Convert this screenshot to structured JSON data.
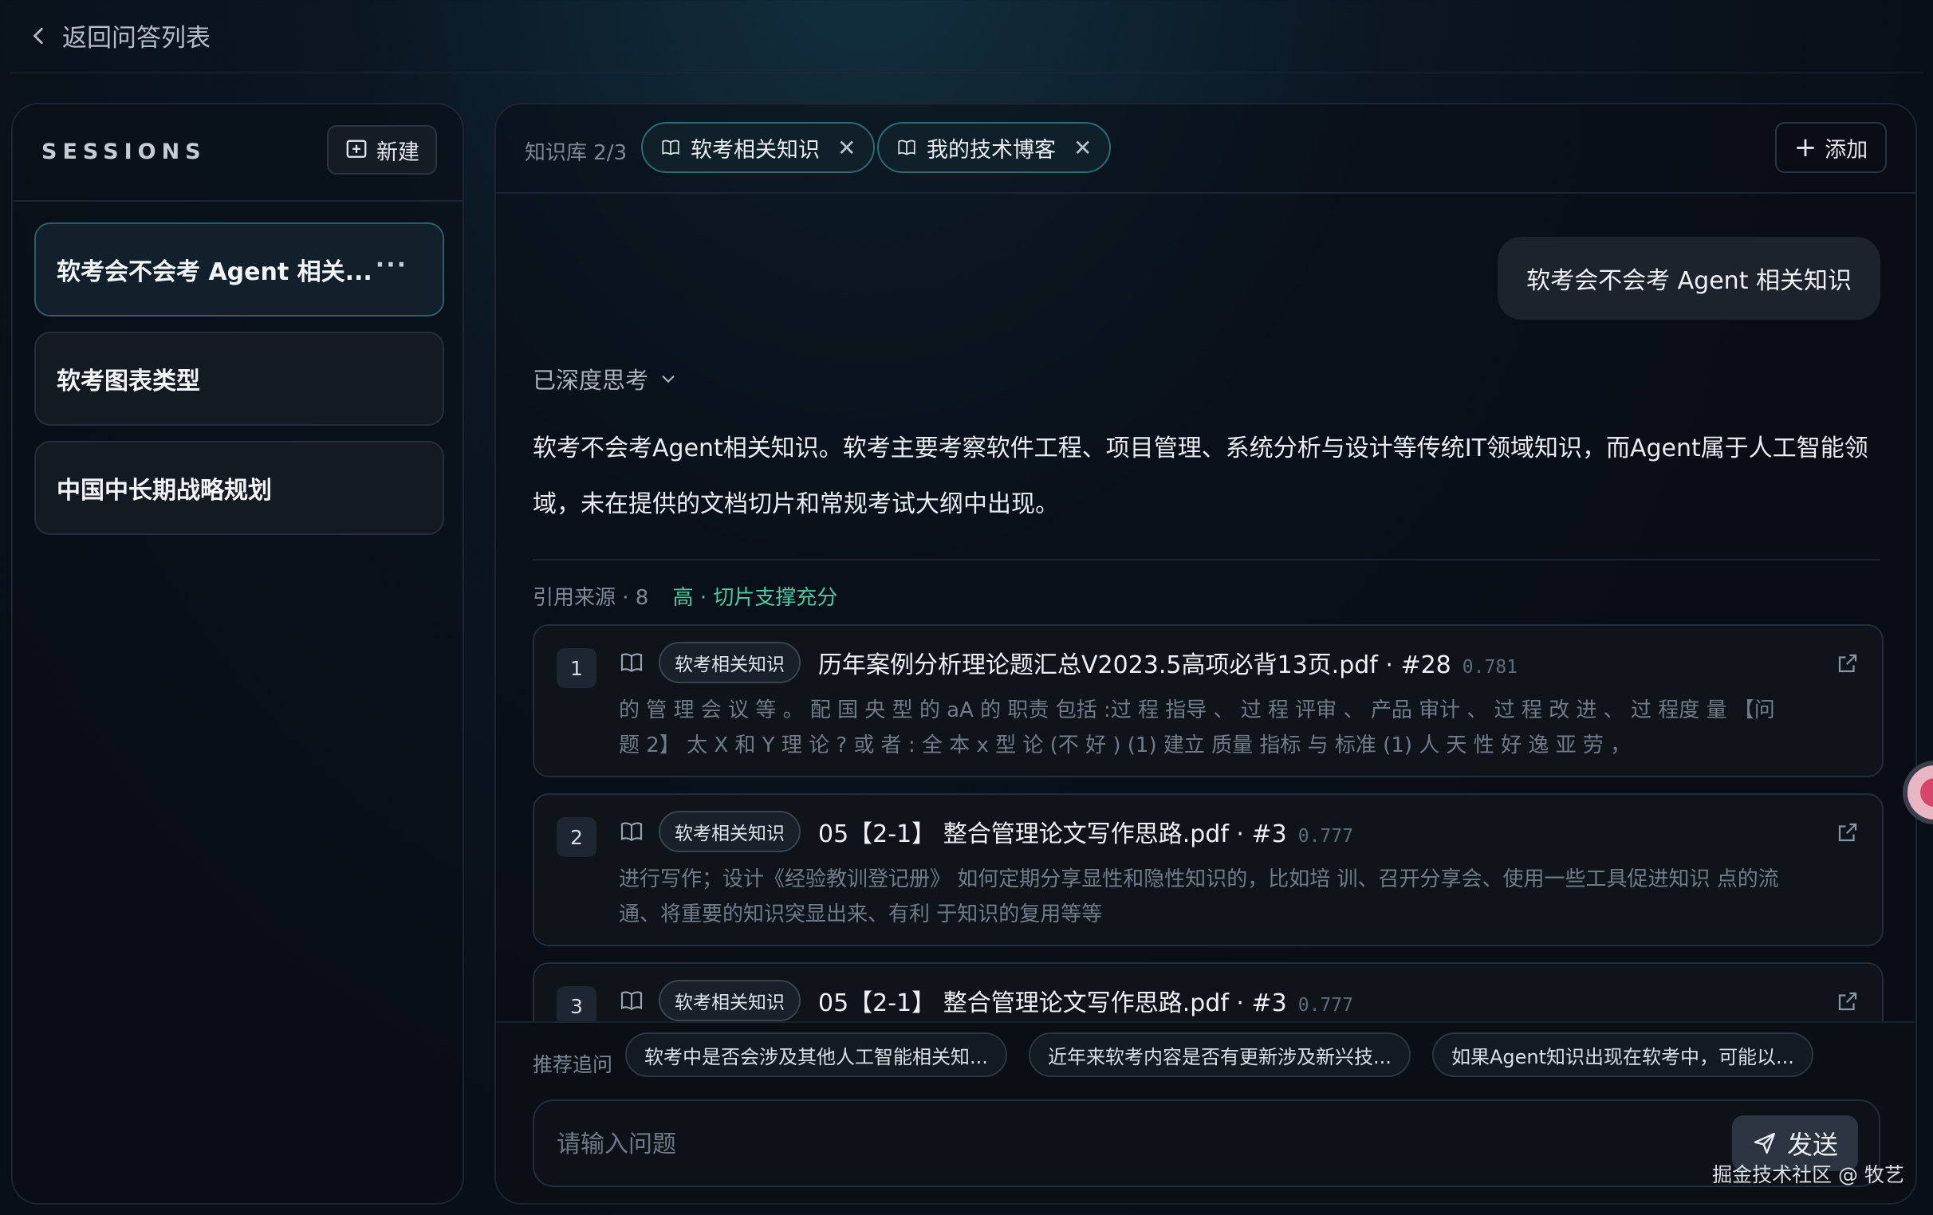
{
  "nav": {
    "back_label": "返回问答列表"
  },
  "sidebar": {
    "title": "SESSIONS",
    "new_label": "新建",
    "sessions": [
      {
        "label": "软考会不会考 Agent 相关...",
        "active": true
      },
      {
        "label": "软考图表类型"
      },
      {
        "label": "中国中长期战略规划"
      }
    ]
  },
  "kb": {
    "label": "知识库 2/3",
    "chips": [
      "软考相关知识",
      "我的技术博客"
    ],
    "add_label": "添加"
  },
  "chat": {
    "user_message": "软考会不会考 Agent 相关知识",
    "thinking_label": "已深度思考",
    "answer": "软考不会考Agent相关知识。软考主要考察软件工程、项目管理、系统分析与设计等传统IT领域知识，而Agent属于人工智能领域，未在提供的文档切片和常规考试大纲中出现。"
  },
  "sources": {
    "header": "引用来源 · 8",
    "quality": "高 · 切片支撑充分",
    "items": [
      {
        "index": "1",
        "tag": "软考相关知识",
        "title": "历年案例分析理论题汇总V2023.5高项必背13页.pdf · #28",
        "score": "0.781",
        "snippet": "的 管 理 会 议 等 。 配 国 央 型 的 aA 的 职责 包括 :过 程 指导 、 过 程 评审 、 产品 审计 、 过 程 改 进 、 过 程度 量 【问题 2】 太 X 和 Y 理 论 ? 或 者 : 全 本 x 型 论 (不 好 ) (1) 建立 质量 指标 与 标准 (1) 人 天 性 好 逸 亚 劳 ，"
      },
      {
        "index": "2",
        "tag": "软考相关知识",
        "title": "05【2-1】 整合管理论文写作思路.pdf · #3",
        "score": "0.777",
        "snippet": "进行写作；设计《经验教训登记册》 如何定期分享显性和隐性知识的，比如培 训、召开分享会、使用一些工具促进知识 点的流通、将重要的知识突显出来、有利 于知识的复用等等"
      },
      {
        "index": "3",
        "tag": "软考相关知识",
        "title": "05【2-1】 整合管理论文写作思路.pdf · #3",
        "score": "0.777",
        "snippet": ""
      }
    ]
  },
  "suggestions": {
    "label": "推荐追问",
    "items": [
      "软考中是否会涉及其他人工智能相关知...",
      "近年来软考内容是否有更新涉及新兴技...",
      "如果Agent知识出现在软考中，可能以..."
    ]
  },
  "input": {
    "placeholder": "请输入问题",
    "send_label": "发送"
  },
  "watermark": "掘金技术社区 @ 牧艺"
}
